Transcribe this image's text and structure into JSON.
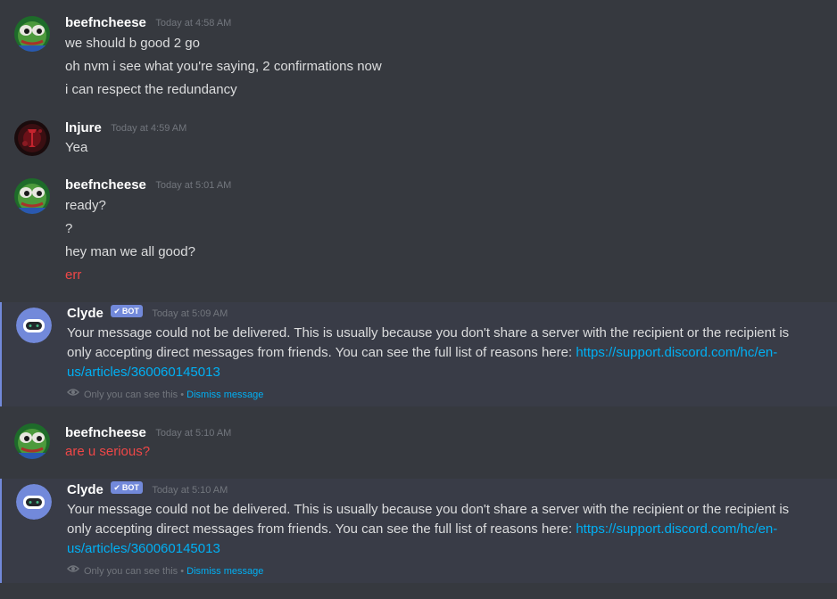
{
  "groups": [
    {
      "username": "beefncheese",
      "timestamp": "Today at 4:58 AM",
      "messages": [
        "we should b good 2 go",
        "oh nvm i see what you're saying, 2 confirmations now",
        "i can respect the redundancy"
      ]
    },
    {
      "username": "lnjure",
      "timestamp": "Today at 4:59 AM",
      "messages": [
        "Yea"
      ]
    },
    {
      "username": "beefncheese",
      "timestamp": "Today at 5:01 AM",
      "messages": [
        "ready?",
        "?",
        "hey man we all good?",
        "err"
      ]
    },
    {
      "username": "Clyde",
      "bot_tag": "BOT",
      "timestamp": "Today at 5:09 AM",
      "message": "Your message could not be delivered. This is usually because you don't share a server with the recipient or the recipient is only accepting direct messages from friends. You can see the full list of reasons here: ",
      "link": "https://support.discord.com/hc/en-us/articles/360060145013",
      "ephemeral_note": "Only you can see this",
      "separator": "•",
      "dismiss_label": "Dismiss message"
    },
    {
      "username": "beefncheese",
      "timestamp": "Today at 5:10 AM",
      "messages": [
        "are u serious?"
      ]
    },
    {
      "username": "Clyde",
      "bot_tag": "BOT",
      "timestamp": "Today at 5:10 AM",
      "message": "Your message could not be delivered. This is usually because you don't share a server with the recipient or the recipient is only accepting direct messages from friends. You can see the full list of reasons here: ",
      "link": "https://support.discord.com/hc/en-us/articles/360060145013",
      "ephemeral_note": "Only you can see this",
      "separator": "•",
      "dismiss_label": "Dismiss message"
    }
  ],
  "colors": {
    "background": "#36393f",
    "bot_row": "#393c47",
    "blurple": "#7289da",
    "error_text": "#f04747",
    "link": "#00b0f4"
  },
  "icons": {
    "frog_avatar": "frog-avatar-icon",
    "lnjure_avatar": "red-dark-avatar-icon",
    "clyde_avatar": "clyde-robot-avatar-icon",
    "bot_check": "checkmark-icon",
    "eye": "eye-icon"
  }
}
